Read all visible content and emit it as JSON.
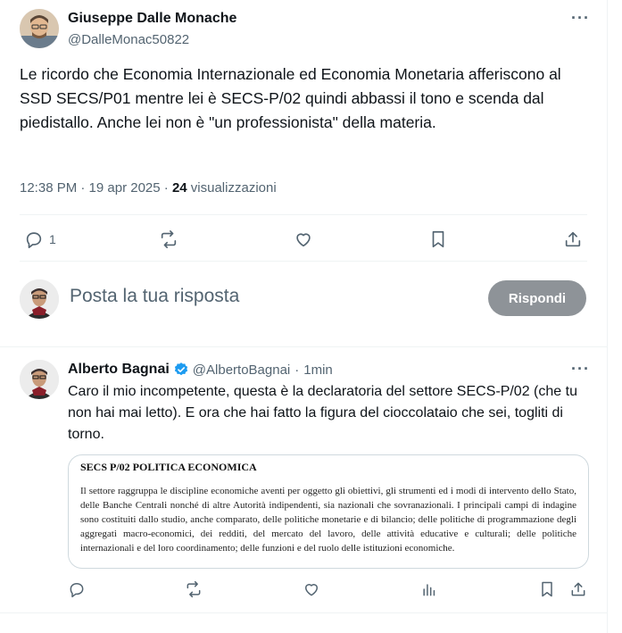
{
  "tweet": {
    "author_name": "Giuseppe Dalle Monache",
    "author_handle": "@DalleMonac50822",
    "more_icon": "more-dots-icon",
    "text": "Le ricordo che Economia Internazionale ed Economia Monetaria afferiscono al SSD SECS/P01 mentre lei è SECS-P/02 quindi abbassi il tono e scenda dal piedistallo. Anche lei non è \"un professionista\" della materia.",
    "timestamp": "12:38 PM · 19 apr 2025 · ",
    "views_count": "24",
    "views_label": " visualizzazioni",
    "actions": {
      "reply_count": "1",
      "icons": [
        "reply-icon",
        "retweet-icon",
        "like-icon",
        "bookmark-icon",
        "share-icon"
      ]
    }
  },
  "composer": {
    "placeholder": "Posta la tua risposta",
    "reply_button": "Rispondi"
  },
  "reply": {
    "author_name": "Alberto Bagnai",
    "author_handle": "@AlbertoBagnai",
    "separator": "·",
    "time": "1min",
    "verified": true,
    "text": "Caro il mio incompetente, questa è la declaratoria del settore SECS-P/02 (che tu non hai mai letto). E ora che hai fatto la figura del cioccolataio che sei, togliti di torno.",
    "attachment": {
      "title": "SECS P/02 POLITICA ECONOMICA",
      "body": "Il settore raggruppa le discipline economiche aventi per oggetto gli obiettivi, gli strumenti ed i modi di intervento dello Stato, delle Banche Centrali nonché di altre Autorità indipendenti, sia nazionali che sovranazionali. I principali campi di indagine sono costituiti dallo studio, anche comparato, delle politiche monetarie e di bilancio; delle politiche di programmazione degli aggregati macro-economici, dei redditi, del mercato del lavoro, delle attività educative e culturali; delle politiche internazionali e del loro coordinamento; delle funzioni e del ruolo delle istituzioni economiche."
    },
    "actions": {
      "icons": [
        "reply-icon",
        "retweet-icon",
        "like-icon",
        "views-icon",
        "bookmark-icon",
        "share-icon"
      ]
    }
  },
  "colors": {
    "text": "#0f1419",
    "secondary": "#536471",
    "divider": "#eff3f4",
    "verified": "#1d9bf0",
    "reply_button_disabled": "#8e9398"
  }
}
